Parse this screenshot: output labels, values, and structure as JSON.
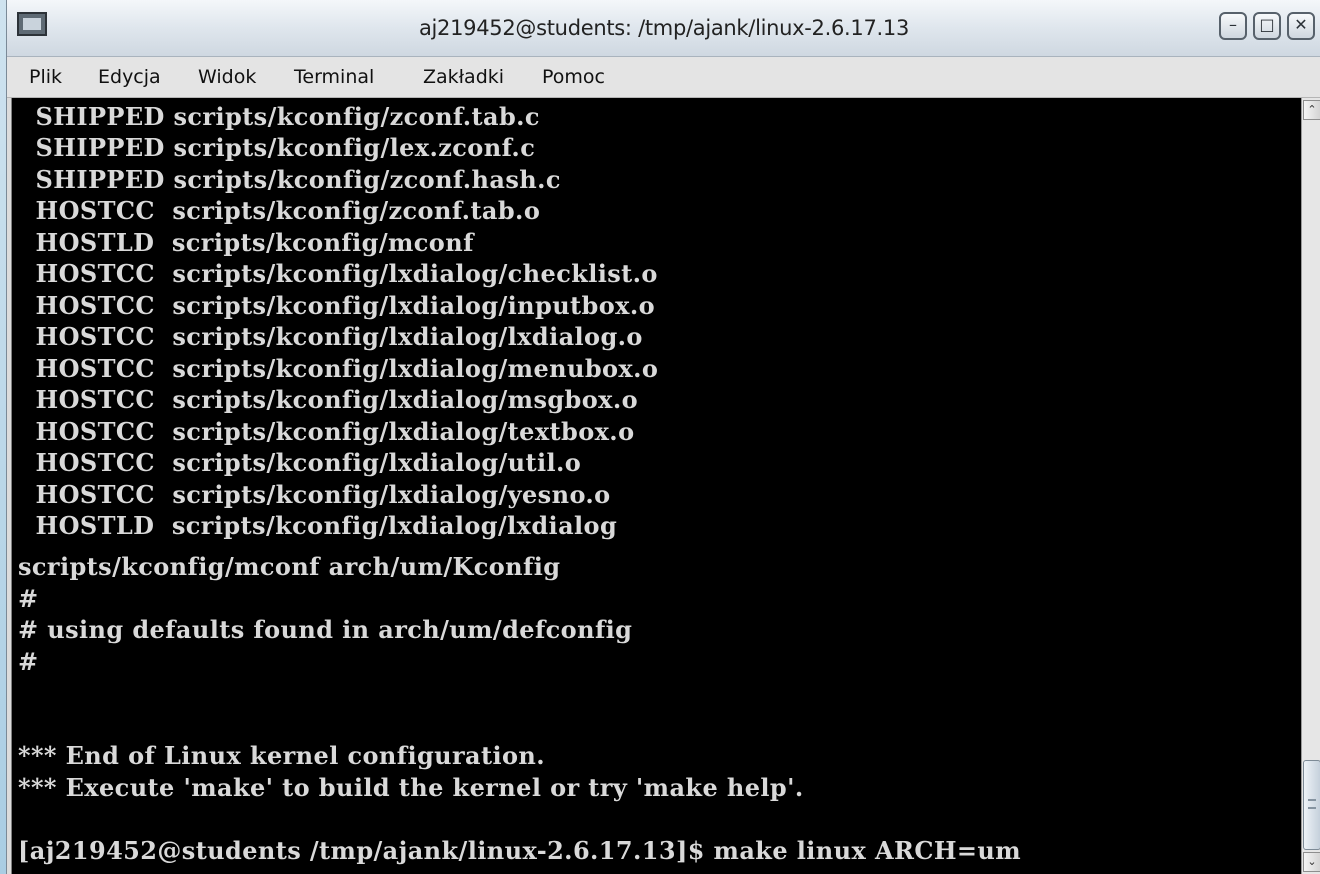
{
  "window": {
    "title": "aj219452@students: /tmp/ajank/linux-2.6.17.13",
    "icon": "terminal-icon",
    "controls": {
      "minimize_glyph": "–",
      "maximize_glyph": "□",
      "close_glyph": "✕"
    }
  },
  "menubar": {
    "items": [
      "Plik",
      "Edycja",
      "Widok",
      "Terminal",
      "Zakładki",
      "Pomoc"
    ]
  },
  "terminal": {
    "lines": [
      "  SHIPPED scripts/kconfig/zconf.tab.c",
      "  SHIPPED scripts/kconfig/lex.zconf.c",
      "  SHIPPED scripts/kconfig/zconf.hash.c",
      "  HOSTCC  scripts/kconfig/zconf.tab.o",
      "  HOSTLD  scripts/kconfig/mconf",
      "  HOSTCC  scripts/kconfig/lxdialog/checklist.o",
      "  HOSTCC  scripts/kconfig/lxdialog/inputbox.o",
      "  HOSTCC  scripts/kconfig/lxdialog/lxdialog.o",
      "  HOSTCC  scripts/kconfig/lxdialog/menubox.o",
      "  HOSTCC  scripts/kconfig/lxdialog/msgbox.o",
      "  HOSTCC  scripts/kconfig/lxdialog/textbox.o",
      "  HOSTCC  scripts/kconfig/lxdialog/util.o",
      "  HOSTCC  scripts/kconfig/lxdialog/yesno.o",
      "  HOSTLD  scripts/kconfig/lxdialog/lxdialog",
      "scripts/kconfig/mconf arch/um/Kconfig",
      "#",
      "# using defaults found in arch/um/defconfig",
      "#",
      "",
      "",
      "*** End of Linux kernel configuration.",
      "*** Execute 'make' to build the kernel or try 'make help'.",
      "",
      "[aj219452@students /tmp/ajank/linux-2.6.17.13]$ make linux ARCH=um"
    ],
    "text_color": "#d9d9d9",
    "background": "#000000"
  },
  "scrollbar": {
    "up_glyph": "⌃",
    "down_glyph": "⌄",
    "position_fraction": 0.92
  }
}
